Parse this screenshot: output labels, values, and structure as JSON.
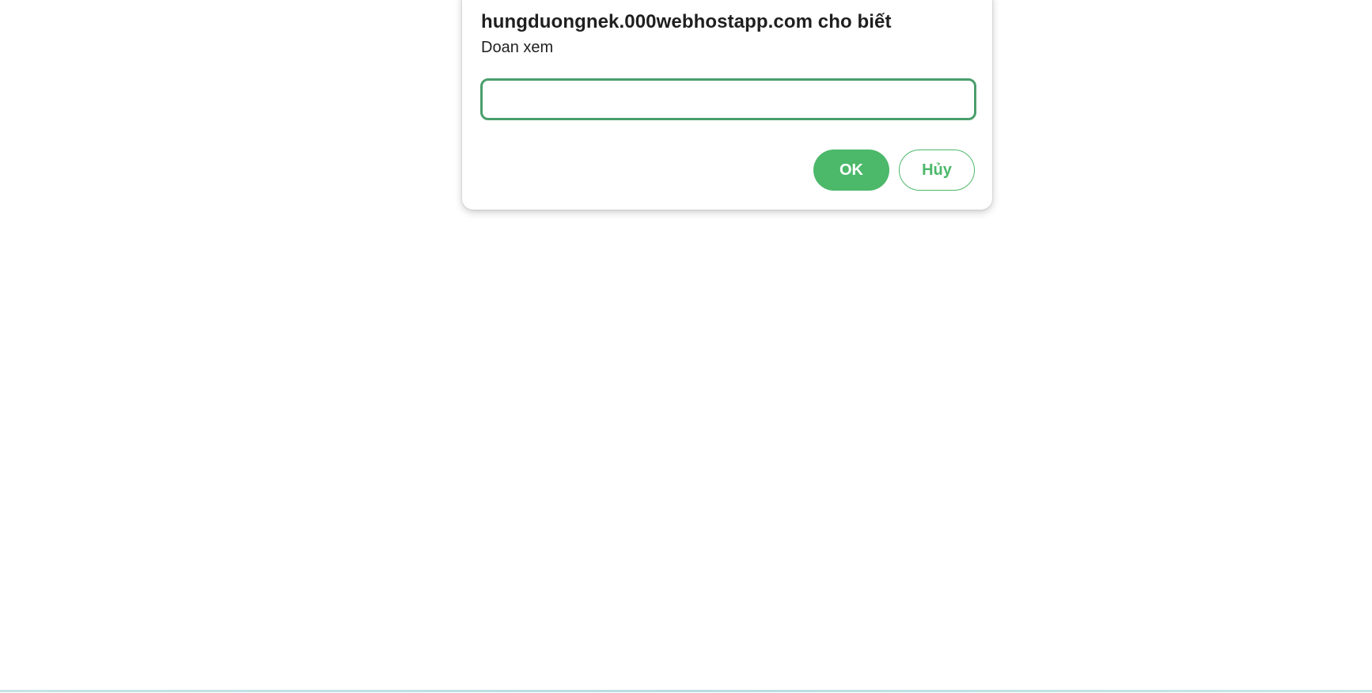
{
  "dialog": {
    "title": "hungduongnek.000webhostapp.com cho biết",
    "message": "Doan xem",
    "input_value": "",
    "ok_label": "OK",
    "cancel_label": "Hủy"
  },
  "colors": {
    "accent": "#4cb86a",
    "input_border": "#4a9e6b",
    "text": "#1f1f1f",
    "bottom_line": "#b8dde2"
  }
}
